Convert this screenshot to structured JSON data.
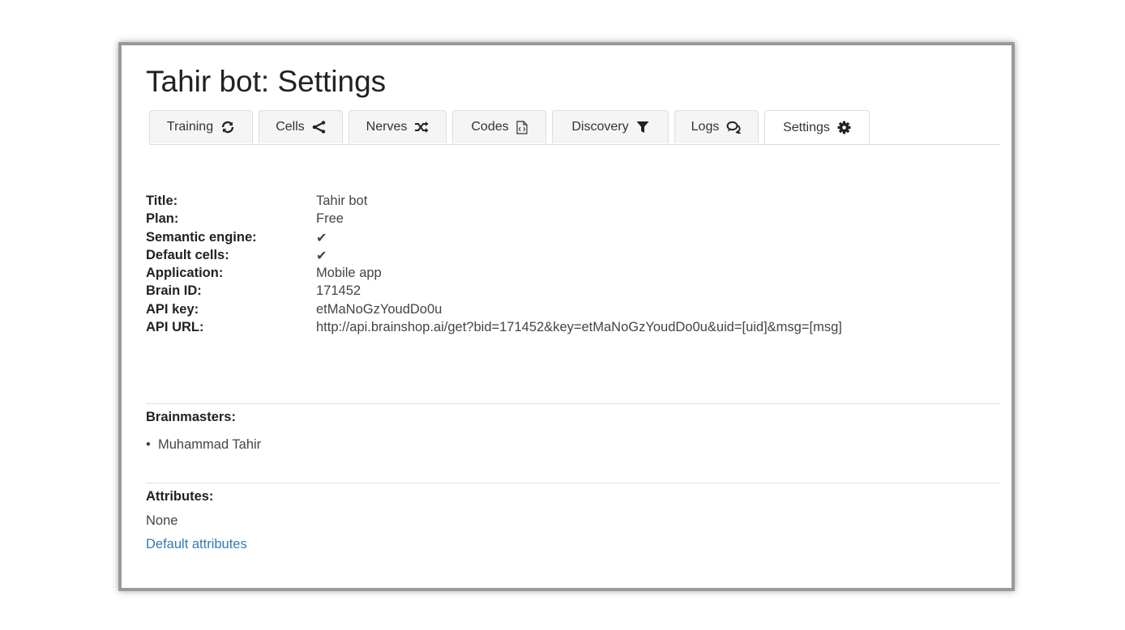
{
  "page": {
    "title": "Tahir bot: Settings"
  },
  "tabs": [
    {
      "label": "Training",
      "icon": "refresh-icon"
    },
    {
      "label": "Cells",
      "icon": "share-icon"
    },
    {
      "label": "Nerves",
      "icon": "random-icon"
    },
    {
      "label": "Codes",
      "icon": "file-code-icon"
    },
    {
      "label": "Discovery",
      "icon": "filter-icon"
    },
    {
      "label": "Logs",
      "icon": "comments-icon"
    },
    {
      "label": "Settings",
      "icon": "gear-icon",
      "active": true
    }
  ],
  "info": {
    "title_label": "Title:",
    "title_value": "Tahir bot",
    "plan_label": "Plan:",
    "plan_value": "Free",
    "semantic_label": "Semantic engine:",
    "semantic_value": "✔",
    "default_cells_label": "Default cells:",
    "default_cells_value": "✔",
    "application_label": "Application:",
    "application_value": "Mobile app",
    "brain_id_label": "Brain ID:",
    "brain_id_value": "171452",
    "api_key_label": "API key:",
    "api_key_value": "etMaNoGzYoudDo0u",
    "api_url_label": "API URL:",
    "api_url_value": "http://api.brainshop.ai/get?bid=171452&key=etMaNoGzYoudDo0u&uid=[uid]&msg=[msg]"
  },
  "brainmasters": {
    "label": "Brainmasters:",
    "items": [
      "Muhammad Tahir"
    ]
  },
  "attributes": {
    "label": "Attributes:",
    "value": "None",
    "link": "Default attributes"
  },
  "colors": {
    "link": "#337ab7",
    "border": "#dddddd",
    "frame": "#9a9a9a"
  }
}
